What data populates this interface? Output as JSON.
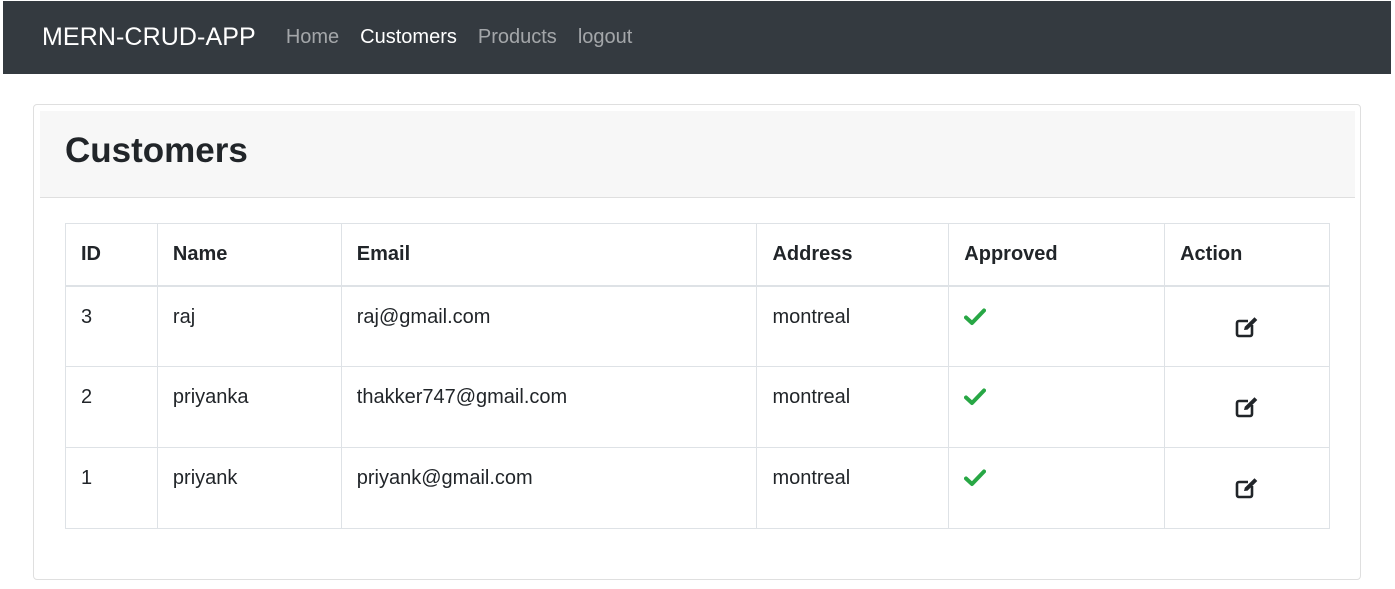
{
  "navbar": {
    "brand": "MERN-CRUD-APP",
    "links": [
      "Home",
      "Customers",
      "Products",
      "logout"
    ],
    "active_link": "Customers"
  },
  "page": {
    "title": "Customers"
  },
  "table": {
    "headers": [
      "ID",
      "Name",
      "Email",
      "Address",
      "Approved",
      "Action"
    ],
    "rows": [
      {
        "id": "3",
        "name": "raj",
        "email": "raj@gmail.com",
        "address": "montreal",
        "approved": true
      },
      {
        "id": "2",
        "name": "priyanka",
        "email": "thakker747@gmail.com",
        "address": "montreal",
        "approved": true
      },
      {
        "id": "1",
        "name": "priyank",
        "email": "priyank@gmail.com",
        "address": "montreal",
        "approved": true
      }
    ]
  },
  "icons": {
    "approved": "check-icon",
    "action": "edit-icon"
  },
  "colors": {
    "navbar_bg": "#343a40",
    "approved_green": "#28a745",
    "header_bg": "#f7f7f7"
  }
}
